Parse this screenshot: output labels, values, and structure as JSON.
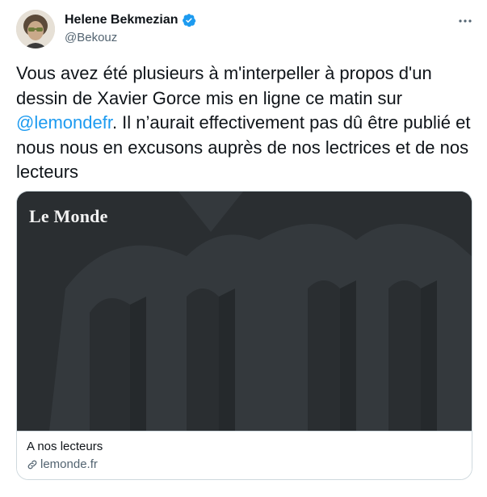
{
  "author": {
    "name": "Helene Bekmezian",
    "handle": "@Bekouz",
    "verified": true,
    "avatar_icon": "user-avatar-photo"
  },
  "more_icon": "more-options-icon",
  "tweet": {
    "text_before": "Vous avez été plusieurs à m'interpeller à propos d'un dessin de Xavier Gorce mis en ligne ce matin sur ",
    "mention": "@lemondefr",
    "text_after": ". Il n’aurait effectivement pas dû être publié et nous nous en excusons auprès de nos lectrices et de nos lecteurs"
  },
  "card": {
    "logo_text": "Le Monde",
    "title": "A nos lecteurs",
    "domain": "lemonde.fr",
    "image_bg": "#2a2e31"
  },
  "colors": {
    "accent": "#1d9bf0",
    "secondary_text": "#536471",
    "border": "#cfd9de"
  }
}
